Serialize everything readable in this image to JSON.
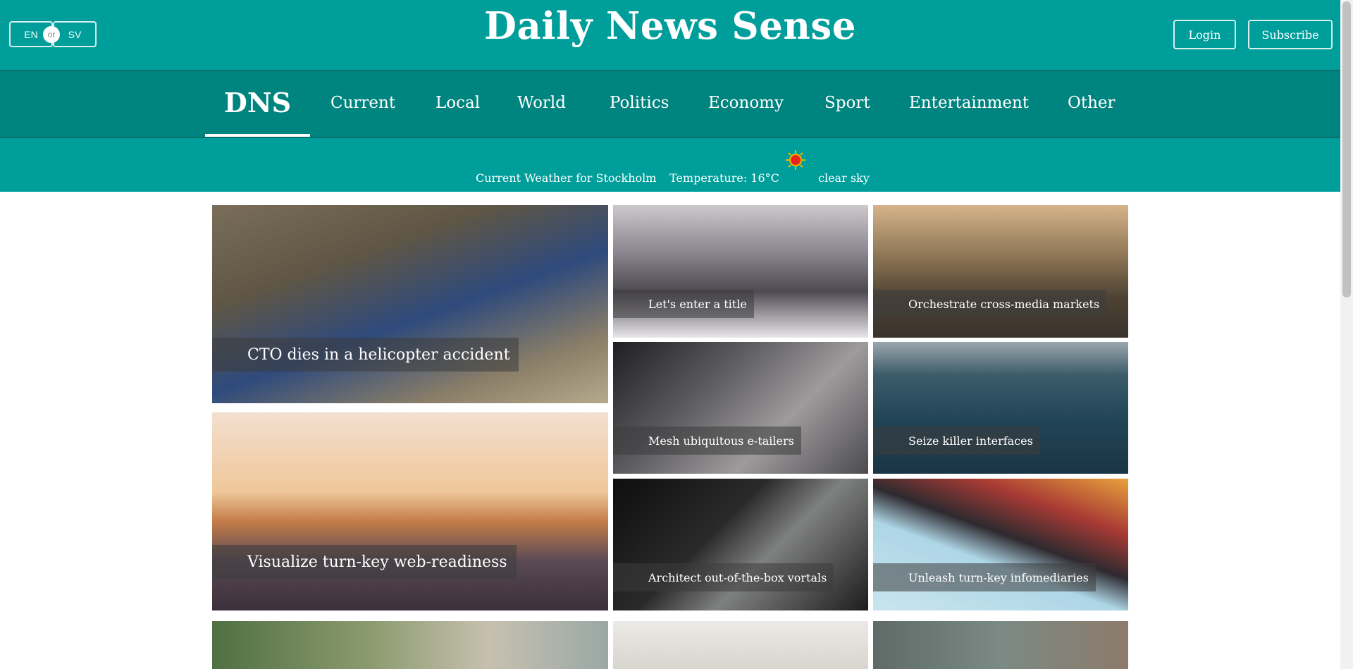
{
  "language": {
    "en": "EN",
    "or": "or",
    "sv": "SV"
  },
  "site_title": "Daily News Sense",
  "header_buttons": {
    "login": "Login",
    "subscribe": "Subscribe"
  },
  "nav": {
    "logo": "DNS",
    "items": [
      "Current",
      "Local",
      "World",
      "Politics",
      "Economy",
      "Sport",
      "Entertainment",
      "Other"
    ]
  },
  "weather": {
    "label": "Current Weather for Stockholm",
    "temperature": "Temperature: 16°C",
    "icon": "sun-icon",
    "condition": "clear sky"
  },
  "articles": [
    {
      "title": "CTO dies in a helicopter accident"
    },
    {
      "title": "Let's enter a title"
    },
    {
      "title": "Orchestrate cross-media markets"
    },
    {
      "title": "Mesh ubiquitous e-tailers"
    },
    {
      "title": "Seize killer interfaces"
    },
    {
      "title": "Visualize turn-key web-readiness"
    },
    {
      "title": "Architect out-of-the-box vortals"
    },
    {
      "title": "Unleash turn-key infomediaries"
    }
  ],
  "colors": {
    "header": "#009e9a",
    "nav": "#00847f",
    "text": "#ffffff"
  }
}
